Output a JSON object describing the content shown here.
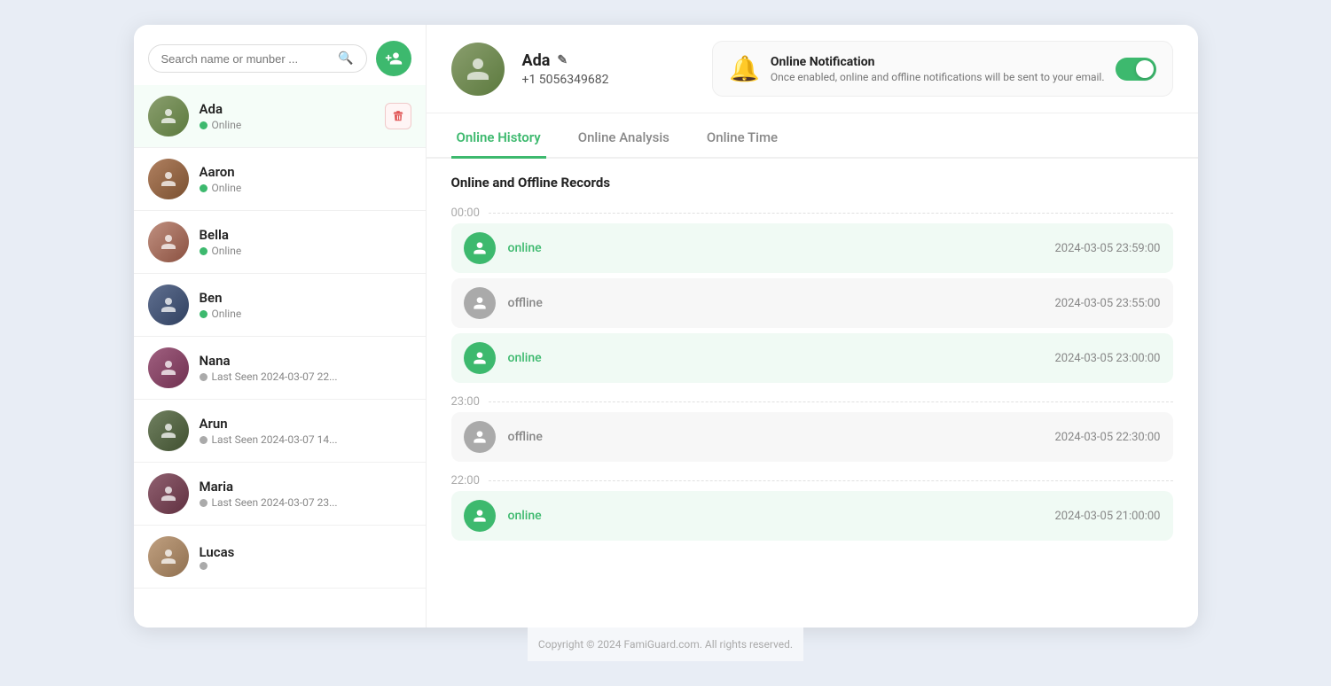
{
  "app": {
    "footer": "Copyright © 2024 FamiGuard.com. All rights reserved."
  },
  "sidebar": {
    "search_placeholder": "Search name or munber ...",
    "add_button_label": "+",
    "contacts": [
      {
        "id": "ada",
        "name": "Ada",
        "status": "Online",
        "status_type": "online",
        "last_seen": "",
        "active": true
      },
      {
        "id": "aaron",
        "name": "Aaron",
        "status": "Online",
        "status_type": "online",
        "last_seen": ""
      },
      {
        "id": "bella",
        "name": "Bella",
        "status": "Online",
        "status_type": "online",
        "last_seen": ""
      },
      {
        "id": "ben",
        "name": "Ben",
        "status": "Online",
        "status_type": "online",
        "last_seen": ""
      },
      {
        "id": "nana",
        "name": "Nana",
        "status": "Last Seen 2024-03-07 22...",
        "status_type": "offline",
        "last_seen": ""
      },
      {
        "id": "arun",
        "name": "Arun",
        "status": "Last Seen 2024-03-07 14...",
        "status_type": "offline",
        "last_seen": ""
      },
      {
        "id": "maria",
        "name": "Maria",
        "status": "Last Seen 2024-03-07 23...",
        "status_type": "offline",
        "last_seen": ""
      },
      {
        "id": "lucas",
        "name": "Lucas",
        "status": "",
        "status_type": "offline",
        "last_seen": ""
      }
    ]
  },
  "profile": {
    "name": "Ada",
    "phone": "+1 5056349682",
    "edit_icon": "✎"
  },
  "notification": {
    "title": "Online Notification",
    "description": "Once enabled, online and offline notifications will be sent to your email.",
    "enabled": true
  },
  "tabs": [
    {
      "id": "history",
      "label": "Online History",
      "active": true
    },
    {
      "id": "analysis",
      "label": "Online Analysis",
      "active": false
    },
    {
      "id": "time",
      "label": "Online Time",
      "active": false
    }
  ],
  "records": {
    "section_title": "Online and Offline Records",
    "time_labels": {
      "top": "00:00",
      "middle": "23:00",
      "bottom": "22:00"
    },
    "entries": [
      {
        "type": "online",
        "label": "online",
        "timestamp": "2024-03-05 23:59:00",
        "group": "top"
      },
      {
        "type": "offline",
        "label": "offline",
        "timestamp": "2024-03-05 23:55:00",
        "group": "top"
      },
      {
        "type": "online",
        "label": "online",
        "timestamp": "2024-03-05 23:00:00",
        "group": "top"
      },
      {
        "type": "offline",
        "label": "offline",
        "timestamp": "2024-03-05 22:30:00",
        "group": "middle"
      },
      {
        "type": "online",
        "label": "online",
        "timestamp": "2024-03-05 21:00:00",
        "group": "bottom"
      }
    ]
  }
}
